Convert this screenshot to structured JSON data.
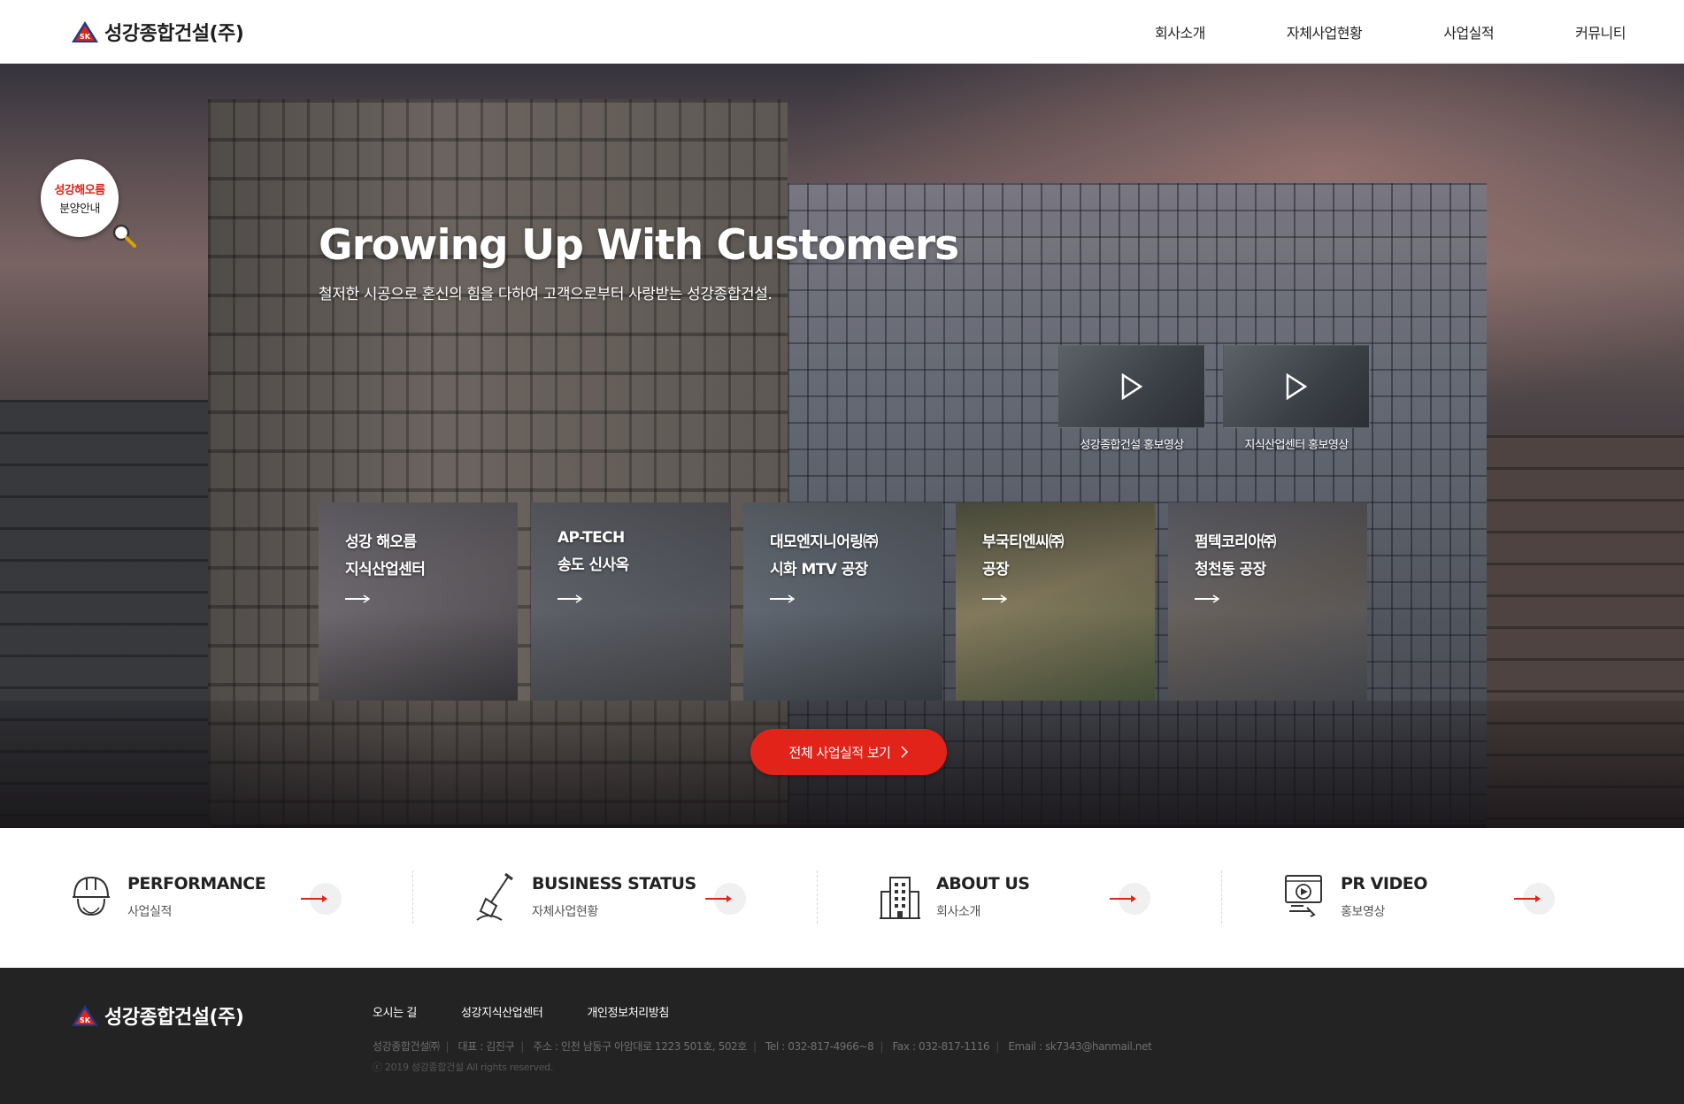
{
  "header": {
    "logo_text": "성강종합건설(주)",
    "logo_mark": "SK",
    "nav": [
      {
        "label": "회사소개"
      },
      {
        "label": "자체사업현황"
      },
      {
        "label": "사업실적"
      },
      {
        "label": "커뮤니티"
      }
    ]
  },
  "hero": {
    "badge": {
      "line1": "성강해오름",
      "line2": "분양안내",
      "icon": "magnifier-icon"
    },
    "title": "Growing Up With Customers",
    "subtitle": "철저한 시공으로 혼신의 힘을 다하여 고객으로부터 사랑받는 성강종합건설.",
    "videos": [
      {
        "caption": "성강종합건설 홍보영상",
        "icon": "play-icon"
      },
      {
        "caption": "지식산업센터 홍보영상",
        "icon": "play-icon"
      }
    ],
    "projects": [
      {
        "line1": "성강 해오름",
        "line2": "지식산업센터",
        "color": "#6f6a6f"
      },
      {
        "line1": "AP-TECH",
        "line2": "송도 신사옥",
        "color": "#5d6068"
      },
      {
        "line1": "대모엔지니어링㈜",
        "line2": "시화 MTV 공장",
        "color": "#5f6670"
      },
      {
        "line1": "부국티엔씨㈜",
        "line2": "공장",
        "color": "#6e6753"
      },
      {
        "line1": "펌텍코리아㈜",
        "line2": "청천동 공장",
        "color": "#69635f"
      }
    ],
    "all_button": "전체 사업실적 보기",
    "all_button_icon": "chevron-right-icon"
  },
  "quick_links": [
    {
      "title": "PERFORMANCE",
      "sub": "사업실적",
      "icon": "hardhat-icon"
    },
    {
      "title": "BUSINESS STATUS",
      "sub": "자체사업현황",
      "icon": "shovel-icon"
    },
    {
      "title": "ABOUT US",
      "sub": "회사소개",
      "icon": "building-icon"
    },
    {
      "title": "PR VIDEO",
      "sub": "홍보영상",
      "icon": "video-icon"
    }
  ],
  "footer": {
    "logo_text": "성강종합건설(주)",
    "links": [
      "오시는 길",
      "성강지식산업센터",
      "개인정보처리방침"
    ],
    "info": [
      "성강종합건설㈜",
      "대표 : 김진구",
      "주소 : 인천 남동구 아암대로 1223 501호, 502호",
      "Tel : 032-817-4966~8",
      "Fax : 032-817-1116",
      "Email : sk7343@hanmail.net"
    ],
    "copyright": "ⓒ 2019 성강종합건설 All rights reserved."
  },
  "colors": {
    "accent": "#e2231a",
    "footer_bg": "#232323"
  }
}
